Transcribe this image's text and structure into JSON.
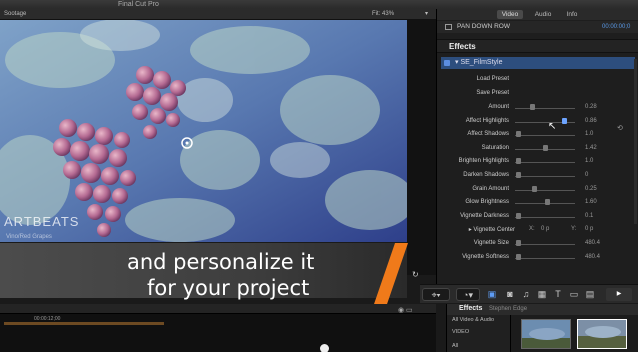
{
  "window": {
    "title": "Final Cut Pro"
  },
  "viewer": {
    "header_left": "Sootage",
    "fit_label": "Fit:",
    "zoom": "43%",
    "watermark": "ARTBEATS",
    "watermark_sub": "Vino/Red Grapes"
  },
  "inspector": {
    "tabs": [
      "Video",
      "Audio",
      "Info"
    ],
    "active_tab": "Video",
    "clip_name": "PAN DOWN ROW",
    "timecode": "00:00:00;0",
    "section_title": "Effects",
    "effect_name": "SE_FilmStyle",
    "actions": [
      "Load Preset",
      "Save Preset"
    ],
    "params": [
      {
        "name": "Amount",
        "value": "0.28",
        "knob": 0.28,
        "active": false
      },
      {
        "name": "Affect Highlights",
        "value": "0.86",
        "knob": 0.86,
        "active": true
      },
      {
        "name": "Affect Shadows",
        "value": "1.0",
        "knob": 0.02,
        "active": false
      },
      {
        "name": "Saturation",
        "value": "1.42",
        "knob": 0.5,
        "active": false
      },
      {
        "name": "Brighten Highlights",
        "value": "1.0",
        "knob": 0.02,
        "active": false
      },
      {
        "name": "Darken Shadows",
        "value": "0",
        "knob": 0.02,
        "active": false
      },
      {
        "name": "Grain Amount",
        "value": "0.25",
        "knob": 0.3,
        "active": false
      },
      {
        "name": "Glow Brightness",
        "value": "1.60",
        "knob": 0.55,
        "active": false
      },
      {
        "name": "Vignette Darkness",
        "value": "0.1",
        "knob": 0.02,
        "active": false
      }
    ],
    "vignette_center": {
      "name": "Vignette Center",
      "x_label": "X:",
      "x_value": "0 p",
      "y_label": "Y:",
      "y_value": "0 p"
    },
    "params2": [
      {
        "name": "Vignette Size",
        "value": "480.4",
        "knob": 0.02
      },
      {
        "name": "Vignette Softness",
        "value": "480.4",
        "knob": 0.02
      }
    ]
  },
  "caption": {
    "line1": "and personalize it",
    "line2": "for your project"
  },
  "toolbar": {
    "icons": [
      "tools-icon",
      "retime-icon",
      "transitions-icon",
      "camera-icon",
      "music-icon",
      "film-icon",
      "text-icon",
      "generators-icon",
      "themes-icon",
      "youtube-icon"
    ]
  },
  "timeline": {
    "timecode": "00:00:12;00"
  },
  "browser": {
    "tab_label": "Effects",
    "category": "Stephen Edge",
    "list": [
      "All Video & Audio",
      "VIDEO",
      "All"
    ]
  },
  "colors": {
    "accent_orange": "#f07a1a",
    "selection_blue": "#2d4e7e",
    "highlight_blue": "#5e9cf5"
  }
}
